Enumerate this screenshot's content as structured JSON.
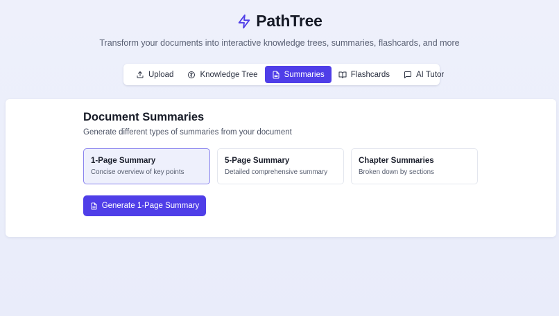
{
  "app": {
    "title": "PathTree",
    "subtitle": "Transform your documents into interactive knowledge trees, summaries, flashcards, and more",
    "logo_icon": "lightning-bolt-icon",
    "accent_color": "#4f3ee8"
  },
  "tabs": [
    {
      "label": "Upload",
      "icon": "upload-icon",
      "active": false
    },
    {
      "label": "Knowledge Tree",
      "icon": "brain-icon",
      "active": false
    },
    {
      "label": "Summaries",
      "icon": "file-text-icon",
      "active": true
    },
    {
      "label": "Flashcards",
      "icon": "book-open-icon",
      "active": false
    },
    {
      "label": "AI Tutor",
      "icon": "message-square-icon",
      "active": false
    }
  ],
  "summaries": {
    "title": "Document Summaries",
    "description": "Generate different types of summaries from your document",
    "options": [
      {
        "title": "1-Page Summary",
        "description": "Concise overview of key points",
        "selected": true
      },
      {
        "title": "5-Page Summary",
        "description": "Detailed comprehensive summary",
        "selected": false
      },
      {
        "title": "Chapter Summaries",
        "description": "Broken down by sections",
        "selected": false
      }
    ],
    "generate_label": "Generate 1-Page Summary",
    "generate_icon": "file-text-icon"
  }
}
